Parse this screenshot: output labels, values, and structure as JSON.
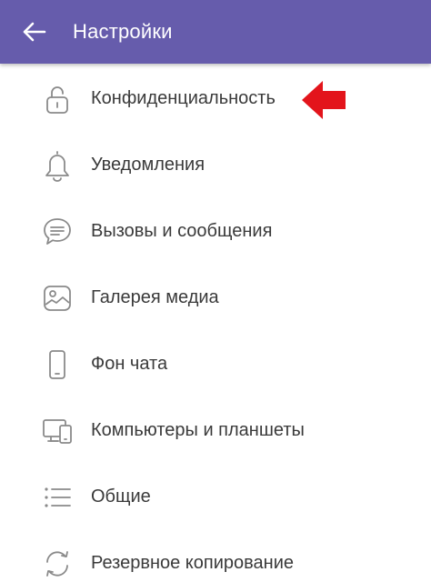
{
  "header": {
    "title": "Настройки",
    "back_icon": "arrow-left-icon",
    "background": "#665CAC"
  },
  "menu": {
    "items": [
      {
        "label": "Конфиденциальность",
        "icon": "lock-icon"
      },
      {
        "label": "Уведомления",
        "icon": "bell-icon"
      },
      {
        "label": "Вызовы и сообщения",
        "icon": "message-icon"
      },
      {
        "label": "Галерея медиа",
        "icon": "image-icon"
      },
      {
        "label": "Фон чата",
        "icon": "phone-icon"
      },
      {
        "label": "Компьютеры и планшеты",
        "icon": "devices-icon"
      },
      {
        "label": "Общие",
        "icon": "list-icon"
      },
      {
        "label": "Резервное копирование",
        "icon": "sync-icon"
      }
    ]
  },
  "annotation": {
    "icon": "red-arrow-icon",
    "color": "#E3141B"
  },
  "colors": {
    "icon": "#8a8a8a",
    "text": "#3a3a3a"
  }
}
